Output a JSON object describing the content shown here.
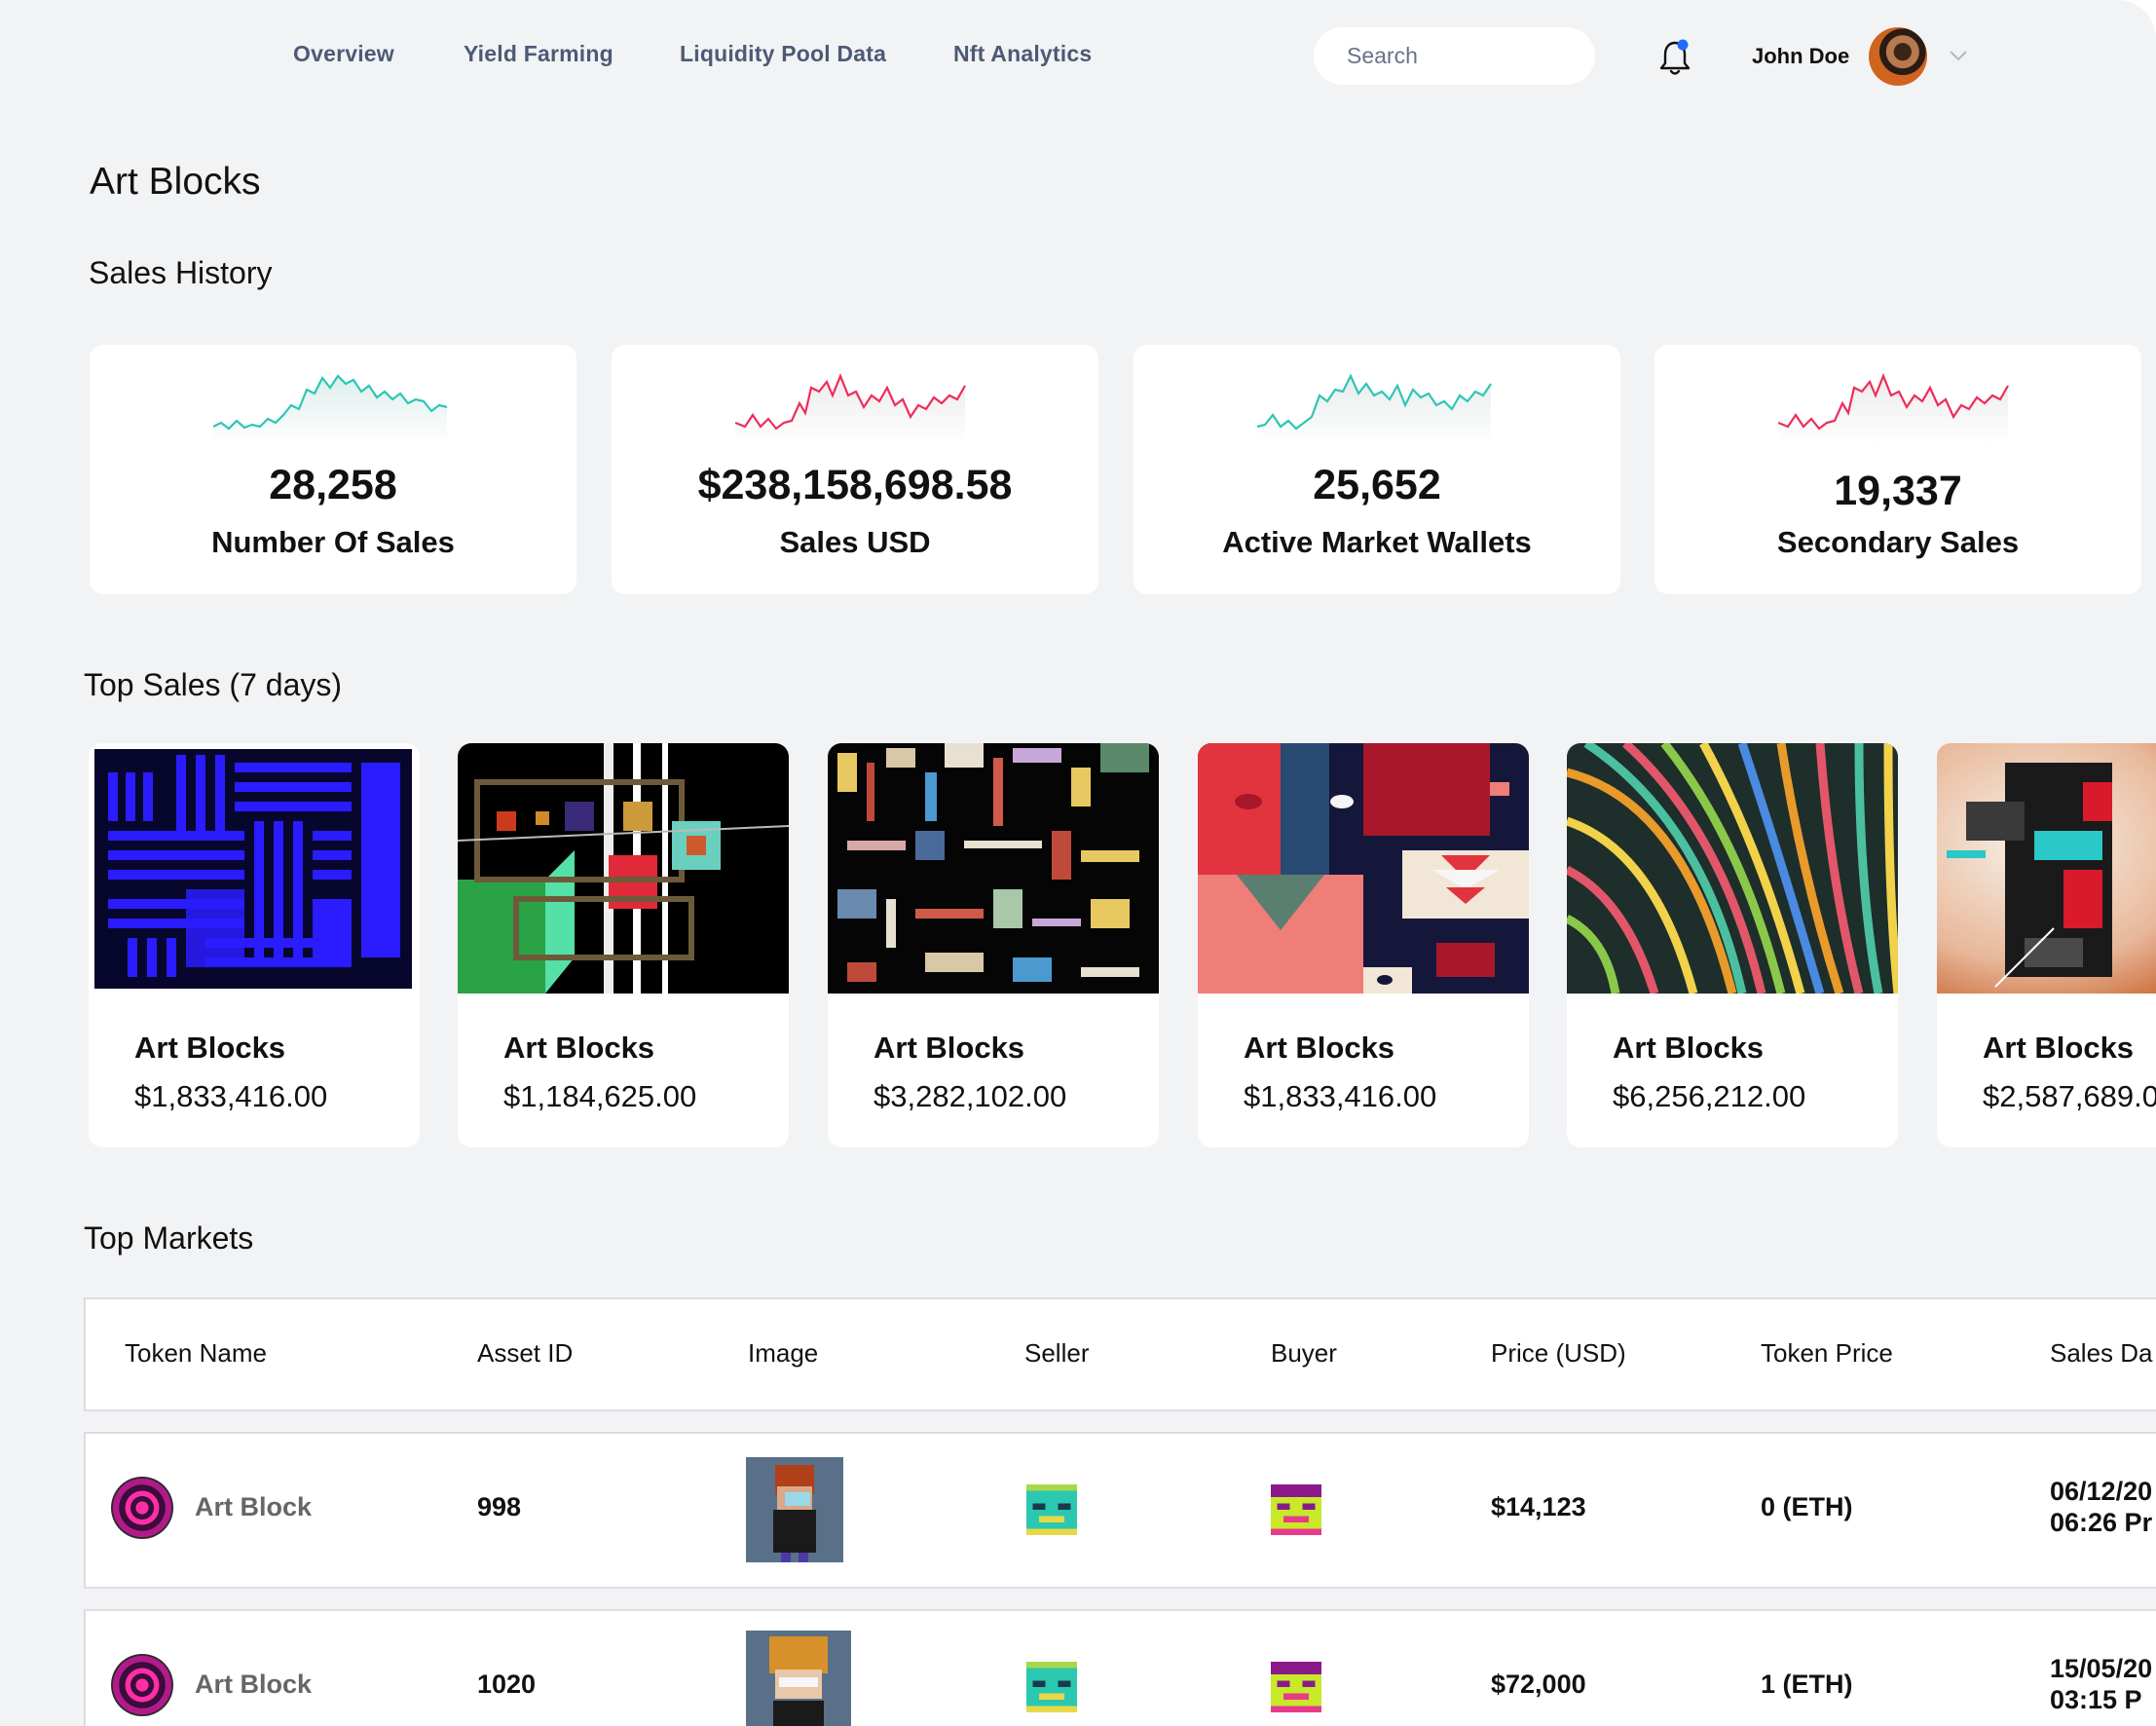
{
  "nav": {
    "links": [
      "Overview",
      "Yield Farming",
      "Liquidity Pool Data",
      "Nft Analytics"
    ],
    "search_placeholder": "Search",
    "user_name": "John Doe"
  },
  "page": {
    "title": "Art Blocks",
    "sales_history_heading": "Sales History",
    "top_sales_heading": "Top Sales (7 days)",
    "top_markets_heading": "Top Markets"
  },
  "stats": [
    {
      "value": "28,258",
      "label": "Number Of Sales",
      "color": "#2dc6b4"
    },
    {
      "value": "$238,158,698.58",
      "label": "Sales USD",
      "color": "#ee2d5a"
    },
    {
      "value": "25,652",
      "label": "Active Market Wallets",
      "color": "#2dc6b4"
    },
    {
      "value": "19,337",
      "label": "Secondary Sales",
      "color": "#ee2d5a"
    }
  ],
  "top_sales": [
    {
      "name": "Art Blocks",
      "price": "$1,833,416.00"
    },
    {
      "name": "Art Blocks",
      "price": "$1,184,625.00"
    },
    {
      "name": "Art Blocks",
      "price": "$3,282,102.00"
    },
    {
      "name": "Art Blocks",
      "price": "$1,833,416.00"
    },
    {
      "name": "Art Blocks",
      "price": "$6,256,212.00"
    },
    {
      "name": "Art Blocks",
      "price": "$2,587,689.0"
    }
  ],
  "table": {
    "headers": [
      "Token Name",
      "Asset ID",
      "Image",
      "Seller",
      "Buyer",
      "Price (USD)",
      "Token Price",
      "Sales Da"
    ],
    "rows": [
      {
        "token_name": "Art Block",
        "asset_id": "998",
        "price": "$14,123",
        "token_price": "0 (ETH)",
        "date": "06/12/20",
        "time": "06:26 Pr"
      },
      {
        "token_name": "Art Block",
        "asset_id": "1020",
        "price": "$72,000",
        "token_price": "1 (ETH)",
        "date": "15/05/20",
        "time": "03:15 P"
      }
    ]
  }
}
